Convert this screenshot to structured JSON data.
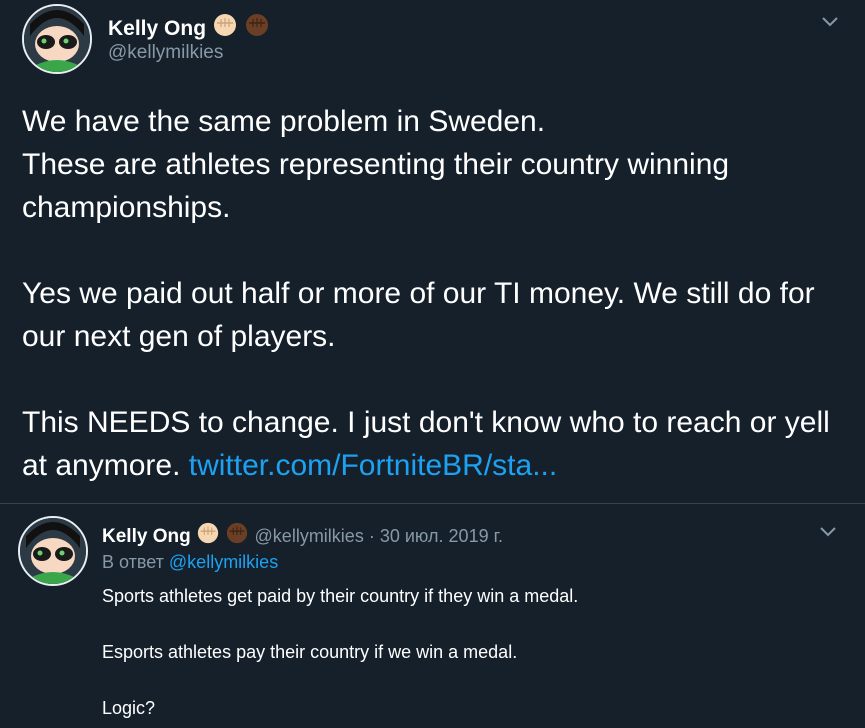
{
  "main_tweet": {
    "author_name": "Kelly Ong",
    "author_handle": "@kellymilkies",
    "text_line1": "We have the same problem in Sweden.",
    "text_line2": "These are athletes representing their country winning championships.",
    "text_line3": "Yes we paid out half or more of our TI money. We still do for our next gen of players.",
    "text_line4": "This NEEDS to change. I just don't know who to reach or yell at anymore.",
    "link_text": "twitter.com/FortniteBR/sta..."
  },
  "reply_tweet": {
    "author_name": "Kelly Ong",
    "author_handle": "@kellymilkies",
    "separator": "·",
    "date": "30 июл. 2019 г.",
    "reply_prefix": "В ответ",
    "reply_to": "@kellymilkies",
    "line1": "Sports athletes get paid by their country if they win a medal.",
    "line2": "Esports athletes pay their country if we win a medal.",
    "line3": "Logic?"
  },
  "icons": {
    "emoji_light": "raised-fist-light-skin-icon",
    "emoji_dark": "raised-fist-dark-skin-icon",
    "more": "chevron-down-icon"
  },
  "colors": {
    "background": "#15202b",
    "text": "#ffffff",
    "secondary": "#8899a6",
    "link": "#1da1f2",
    "divider": "#38444d"
  }
}
